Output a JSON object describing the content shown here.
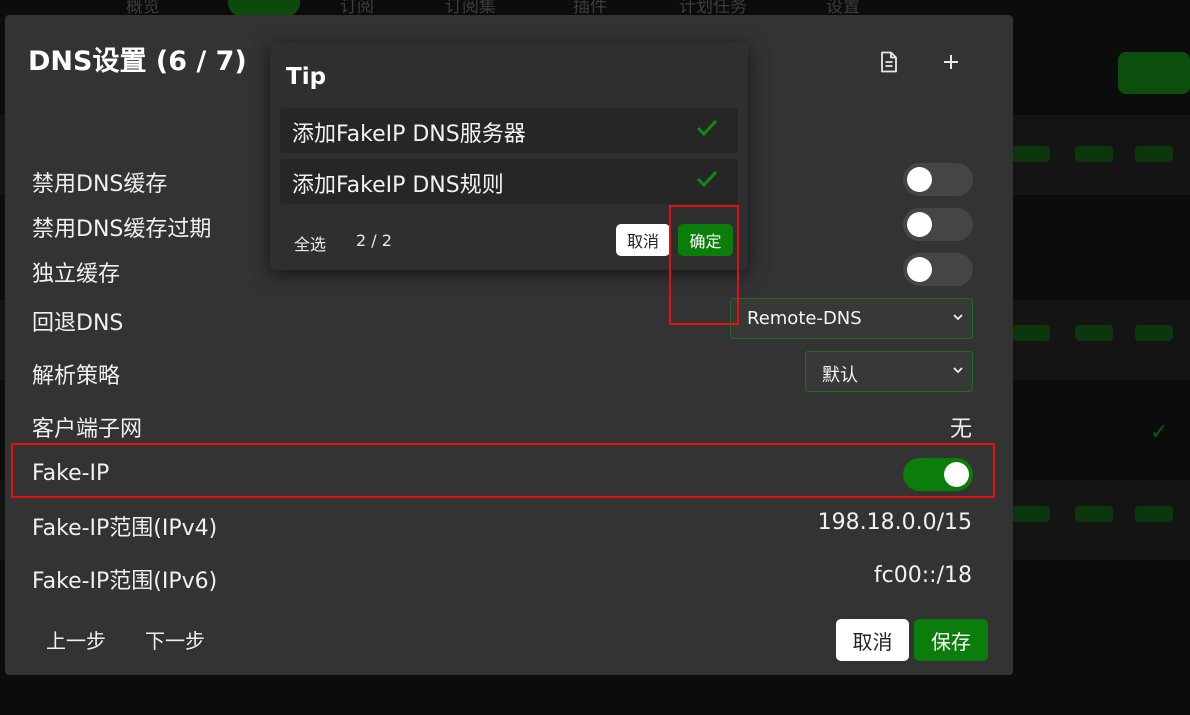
{
  "background": {
    "nav_items": [
      "概览",
      "订阅",
      "订阅集",
      "插件",
      "计划任务",
      "设置"
    ],
    "nav_icons": [
      "dashboard-icon",
      "filter-icon",
      "subscriptions-icon",
      "plugin-icon",
      "schedule-icon",
      "gear-icon"
    ]
  },
  "dialog": {
    "title": "DNS设置 (6 / 7)",
    "header_icons": [
      "document-icon",
      "plus-icon"
    ],
    "rows": {
      "disable_cache": {
        "label": "禁用DNS缓存",
        "on": false
      },
      "disable_expire": {
        "label": "禁用DNS缓存过期",
        "on": false
      },
      "independent_cache": {
        "label": "独立缓存",
        "on": false
      },
      "fallback_dns": {
        "label": "回退DNS",
        "value": "Remote-DNS"
      },
      "strategy": {
        "label": "解析策略",
        "value": "默认"
      },
      "client_subnet": {
        "label": "客户端子网",
        "value": "无"
      },
      "fake_ip": {
        "label": "Fake-IP",
        "on": true
      },
      "fake_ip_v4": {
        "label": "Fake-IP范围(IPv4)",
        "value": "198.18.0.0/15"
      },
      "fake_ip_v6": {
        "label": "Fake-IP范围(IPv6)",
        "value": "fc00::/18"
      }
    },
    "footer": {
      "prev": "上一步",
      "next": "下一步",
      "cancel": "取消",
      "save": "保存"
    }
  },
  "tip": {
    "title": "Tip",
    "items": [
      {
        "label": "添加FakeIP DNS服务器",
        "checked": true
      },
      {
        "label": "添加FakeIP DNS规则",
        "checked": true
      }
    ],
    "select_all": "全选",
    "count": "2 / 2",
    "cancel": "取消",
    "confirm": "确定"
  },
  "colors": {
    "accent_green": "#0a7d0a",
    "highlight_red": "#e01010",
    "dialog_bg": "#333333"
  }
}
